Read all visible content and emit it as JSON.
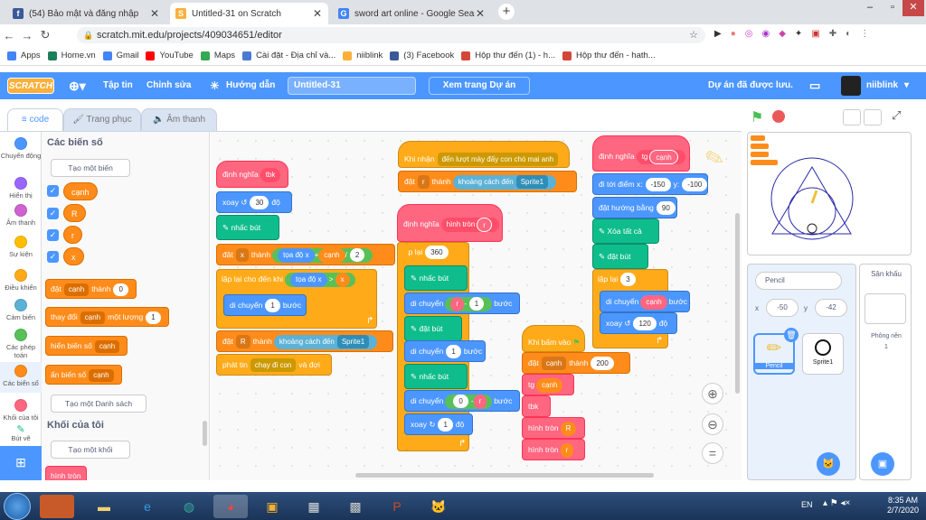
{
  "browser": {
    "tabs": [
      {
        "title": "(54) Bảo mật và đăng nhập",
        "favicon": "f"
      },
      {
        "title": "Untitled-31 on Scratch",
        "favicon": "S"
      },
      {
        "title": "sword art online - Google Search",
        "favicon": "G"
      }
    ],
    "url": "scratch.mit.edu/projects/409034651/editor",
    "bookmarks": [
      "Apps",
      "Home.vn",
      "Gmail",
      "YouTube",
      "Maps",
      "Cài đặt - Địa chỉ và...",
      "niiblink",
      "(3) Facebook",
      "Hộp thư đến (1) - h...",
      "Hộp thư đến - hath..."
    ]
  },
  "menubar": {
    "logo": "SCRATCH",
    "file": "Tập tin",
    "edit": "Chỉnh sửa",
    "tutorials": "Hướng dẫn",
    "project_title": "Untitled-31",
    "see_project_page": "Xem trang Dự án",
    "saved": "Dự án đã được lưu.",
    "username": "niiblink"
  },
  "editor_tabs": {
    "code": "code",
    "costumes": "Trang phục",
    "sounds": "Âm thanh"
  },
  "categories": [
    {
      "label": "Chuyển động",
      "color": "#4c97ff"
    },
    {
      "label": "Hiển thị",
      "color": "#9966ff"
    },
    {
      "label": "Âm thanh",
      "color": "#cf63cf"
    },
    {
      "label": "Sự kiện",
      "color": "#ffbf00"
    },
    {
      "label": "Điều khiển",
      "color": "#ffab19"
    },
    {
      "label": "Cảm biến",
      "color": "#5cb1d6"
    },
    {
      "label": "Các phép toán",
      "color": "#59c059"
    },
    {
      "label": "Các biến số",
      "color": "#ff8c1a"
    },
    {
      "label": "Khối của tôi",
      "color": "#ff6680"
    },
    {
      "label": "Bút vẽ",
      "color": "#0fbd8c"
    }
  ],
  "palette": {
    "heading": "Các biến số",
    "make_variable": "Tạo một biến",
    "variables": [
      "cạnh",
      "R",
      "r",
      "x"
    ],
    "set_block": {
      "label": "đặt",
      "var": "cạnh",
      "to": "thành",
      "value": "0"
    },
    "change_block": {
      "label": "thay đổi",
      "var": "cạnh",
      "by": "một lượng",
      "value": "1"
    },
    "show_block": {
      "label": "hiển biến số",
      "var": "cạnh"
    },
    "hide_block": {
      "label": "ẩn biến số",
      "var": "cạnh"
    },
    "make_list": "Tạo một Danh sách",
    "my_blocks_heading": "Khối của tôi",
    "make_block": "Tạo một khối",
    "circle_block": "hình tròn"
  },
  "scripts": {
    "s1": {
      "define": "định nghĩa",
      "name": "tbk",
      "turn": "xoay",
      "turn_val": "30",
      "deg": "độ",
      "pendown": "nhấc bút",
      "set": "đặt",
      "x": "x",
      "to": "thành",
      "xpos": "tọa độ x",
      "plus": "+",
      "canh": "cạnh",
      "div": "/",
      "two": "2",
      "repeat_until": "lặp lại cho đến khi",
      "gt": ">",
      "move": "di chuyển",
      "one": "1",
      "steps": "bước",
      "setR": "R",
      "distance": "khoảng cách đến",
      "sprite1": "Sprite1",
      "broadcast": "phát tin",
      "chase": "chạy đi con",
      "and_wait": "và đợi"
    },
    "s2": {
      "when_receive": "Khi nhận",
      "msg": "đến lượt mày đấy con chó mai anh",
      "set": "đặt",
      "r": "r",
      "to": "thành",
      "distance": "khoảng cách đến",
      "sprite1": "Sprite1"
    },
    "s3": {
      "define": "định nghĩa",
      "name": "hình tròn",
      "param": "r",
      "repeat": "lặp lại",
      "count": "360",
      "penup": "nhấc bút",
      "move": "di chuyển",
      "r": "r",
      "minus": "-",
      "one": "1",
      "steps": "bước",
      "pendown": "đặt bút",
      "zero": "0",
      "turn": "xoay",
      "deg": "độ"
    },
    "s4": {
      "define": "định nghĩa",
      "name": "tg",
      "param": "cạnh",
      "goto": "đi tới điểm x:",
      "x": "-150",
      "y_label": "y:",
      "y": "-100",
      "point": "đặt hướng bằng",
      "dir": "90",
      "clear": "Xóa tất cả",
      "pendown": "đặt bút",
      "repeat": "lặp lại",
      "count": "3",
      "move": "di chuyển",
      "canh": "cạnh",
      "steps": "bước",
      "turn": "xoay",
      "deg_val": "120",
      "deg": "độ"
    },
    "s5": {
      "when_flag": "Khi bấm vào",
      "set": "đặt",
      "var": "cạnh",
      "to": "thành",
      "value": "200",
      "tg": "tg",
      "canh": "cạnh",
      "tbk": "tbk",
      "circle": "hình tròn",
      "R": "R",
      "r": "r"
    }
  },
  "sprite_info": {
    "name": "Pencil",
    "x_label": "x",
    "x": "-50",
    "y_label": "y",
    "y": "-42",
    "sprites": [
      "Pencil",
      "Sprite1"
    ]
  },
  "stage_panel": {
    "label": "Sân khấu",
    "backdrops_label": "Phông nền",
    "backdrops_count": "1"
  },
  "taskbar": {
    "lang": "EN",
    "time": "8:35 AM",
    "date": "2/7/2020"
  }
}
